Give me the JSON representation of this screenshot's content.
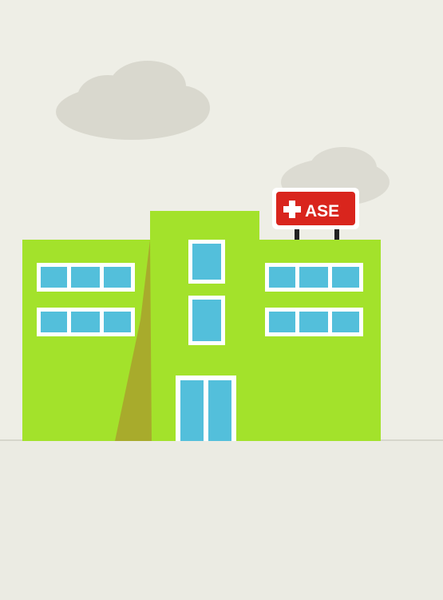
{
  "sign": {
    "label": "ASE",
    "icon": "medical-cross-icon"
  },
  "colors": {
    "background": "#eeeee6",
    "ground": "#ebebe3",
    "building": "#a3e22b",
    "building_shadow": "#a8ab2c",
    "window_frame": "#ffffff",
    "window_glass": "#53bfdb",
    "cloud": "#d9d8ce",
    "sign_red": "#d9251d",
    "sign_text": "#ffffff",
    "sign_post": "#222222"
  }
}
